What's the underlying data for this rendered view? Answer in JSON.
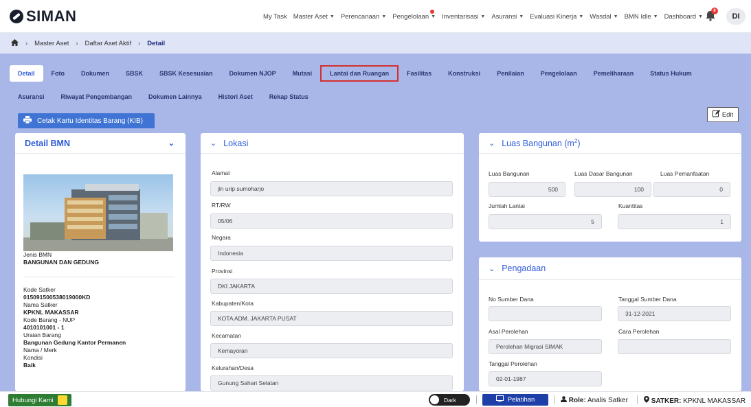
{
  "app": {
    "logo_text": "SIMAN"
  },
  "nav": {
    "items": [
      {
        "label": "My Task",
        "caret": false
      },
      {
        "label": "Master Aset",
        "caret": true
      },
      {
        "label": "Perencanaan",
        "caret": true
      },
      {
        "label": "Pengelolaan",
        "caret": true,
        "dot": true
      },
      {
        "label": "Inventarisasi",
        "caret": true
      },
      {
        "label": "Asuransi",
        "caret": true
      },
      {
        "label": "Evaluasi Kinerja",
        "caret": true
      },
      {
        "label": "Wasdal",
        "caret": true
      },
      {
        "label": "BMN Idle",
        "caret": true
      },
      {
        "label": "Dashboard",
        "caret": true
      }
    ],
    "notification_count": "6",
    "avatar_initials": "DI"
  },
  "breadcrumb": {
    "item1": "Master Aset",
    "item2": "Daftar Aset Aktif",
    "current": "Detail"
  },
  "tabs": {
    "row1": [
      "Detail",
      "Foto",
      "Dokumen",
      "SBSK",
      "SBSK Kesesuaian",
      "Dokumen NJOP",
      "Mutasi",
      "Lantai dan Ruangan",
      "Fasilitas",
      "Konstruksi",
      "Penilaian",
      "Pengelolaan",
      "Pemeliharaan",
      "Status Hukum"
    ],
    "row2": [
      "Asuransi",
      "Riwayat Pengembangan",
      "Dokumen Lainnya",
      "Histori Aset",
      "Rekap Status"
    ]
  },
  "actions": {
    "kib_label": "Cetak Kartu Identitas Barang (KIB)",
    "edit_label": "Edit"
  },
  "detail_bmn": {
    "title": "Detail BMN",
    "jenis_label": "Jenis BMN",
    "jenis_value": "BANGUNAN DAN GEDUNG",
    "kode_satker_label": "Kode Satker",
    "kode_satker_value": "015091500538019000KD",
    "nama_satker_label": "Nama Satker",
    "nama_satker_value": "KPKNL MAKASSAR",
    "kode_barang_label": "Kode Barang - NUP",
    "kode_barang_value": "4010101001 - 1",
    "uraian_label": "Uraian Barang",
    "uraian_value": "Bangunan Gedung Kantor Permanen",
    "merk_label": "Nama / Merk",
    "kondisi_label": "Kondisi",
    "kondisi_value": "Baik"
  },
  "lokasi": {
    "title": "Lokasi",
    "alamat_label": "Alamat",
    "alamat_value": "jln urip sumoharjo",
    "rtrw_label": "RT/RW",
    "rtrw_value": "05/06",
    "negara_label": "Negara",
    "negara_value": "Indonesia",
    "provinsi_label": "Provinsi",
    "provinsi_value": "DKI JAKARTA",
    "kabkota_label": "Kabupaten/Kota",
    "kabkota_value": "KOTA ADM. JAKARTA PUSAT",
    "kecamatan_label": "Kecamatan",
    "kecamatan_value": "Kemayoran",
    "kelurahan_label": "Kelurahan/Desa",
    "kelurahan_value": "Gunung Sahari Selatan"
  },
  "luas": {
    "title": "Luas Bangunan (m",
    "title_sup": "2",
    "title_end": ")",
    "luas_bangunan_label": "Luas Bangunan",
    "luas_bangunan_value": "500",
    "luas_dasar_label": "Luas Dasar Bangunan",
    "luas_dasar_value": "100",
    "luas_pemanfaatan_label": "Luas Pemanfaatan",
    "luas_pemanfaatan_value": "0",
    "jumlah_lantai_label": "Jumlah Lantai",
    "jumlah_lantai_value": "5",
    "kuantitas_label": "Kuantitas",
    "kuantitas_value": "1"
  },
  "pengadaan": {
    "title": "Pengadaan",
    "no_sumber_label": "No Sumber Dana",
    "no_sumber_value": "",
    "tgl_sumber_label": "Tanggal Sumber Dana",
    "tgl_sumber_value": "31-12-2021",
    "asal_label": "Asal Perolehan",
    "asal_value": "Perolehan Migrasi SIMAK",
    "cara_label": "Cara Perolehan",
    "cara_value": "",
    "tgl_perolehan_label": "Tanggal Perolehan",
    "tgl_perolehan_value": "02-01-1987"
  },
  "footer": {
    "hubungi_label": "Hubungi Kami",
    "dark_label": "Dark",
    "pelatihan_label": "Pelatihan",
    "role_label": "Role:",
    "role_value": "Analis Satker",
    "satker_label": "SATKER:",
    "satker_value": "KPKNL MAKASSAR"
  },
  "colors": {
    "accent": "#2e5bd8",
    "background": "#a9b7e8",
    "highlight": "#d32f2f"
  }
}
